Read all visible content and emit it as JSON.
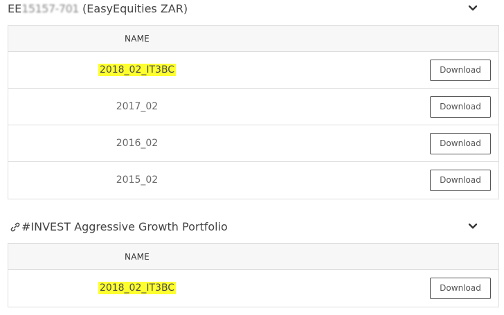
{
  "sections": [
    {
      "title_prefix": "EE",
      "title_masked": "15157-701",
      "title_suffix": "(EasyEquities ZAR)",
      "expand_icon": "chevron-down-icon",
      "header": {
        "name": "NAME"
      },
      "rows": [
        {
          "name": "2018_02_IT3BC",
          "highlighted": true,
          "action": "Download"
        },
        {
          "name": "2017_02",
          "highlighted": false,
          "action": "Download"
        },
        {
          "name": "2016_02",
          "highlighted": false,
          "action": "Download"
        },
        {
          "name": "2015_02",
          "highlighted": false,
          "action": "Download"
        }
      ]
    },
    {
      "icon": "link-icon",
      "title": "#INVEST Aggressive Growth Portfolio",
      "expand_icon": "chevron-down-icon",
      "header": {
        "name": "NAME"
      },
      "rows": [
        {
          "name": "2018_02_IT3BC",
          "highlighted": true,
          "action": "Download"
        }
      ]
    }
  ],
  "colors": {
    "highlight": "#fdff2f",
    "border": "#dddddd",
    "header_bg": "#f7f7f7"
  }
}
